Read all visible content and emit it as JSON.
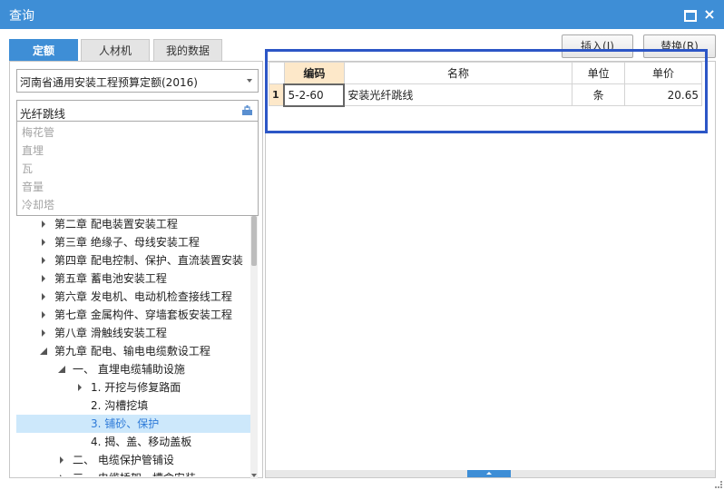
{
  "window": {
    "title": "查询"
  },
  "tabs": [
    {
      "label": "定额",
      "active": true
    },
    {
      "label": "人材机",
      "active": false
    },
    {
      "label": "我的数据",
      "active": false
    }
  ],
  "quota_select": {
    "value": "河南省通用安装工程预算定额(2016)"
  },
  "search": {
    "value": "光纤跳线"
  },
  "suggestions": [
    "梅花管",
    "直埋",
    "瓦",
    "音量",
    "冷却塔"
  ],
  "tree": [
    {
      "label": "第二章  配电装置安装工程",
      "level": 0,
      "state": "collapsed"
    },
    {
      "label": "第三章  绝缘子、母线安装工程",
      "level": 0,
      "state": "collapsed"
    },
    {
      "label": "第四章  配电控制、保护、直流装置安装",
      "level": 0,
      "state": "collapsed"
    },
    {
      "label": "第五章  蓄电池安装工程",
      "level": 0,
      "state": "collapsed"
    },
    {
      "label": "第六章  发电机、电动机检查接线工程",
      "level": 0,
      "state": "collapsed"
    },
    {
      "label": "第七章  金属构件、穿墙套板安装工程",
      "level": 0,
      "state": "collapsed"
    },
    {
      "label": "第八章  滑触线安装工程",
      "level": 0,
      "state": "collapsed"
    },
    {
      "label": "第九章  配电、输电电缆敷设工程",
      "level": 0,
      "state": "expanded"
    },
    {
      "label": "一、  直埋电缆辅助设施",
      "level": 1,
      "state": "expanded"
    },
    {
      "label": "1.  开挖与修复路面",
      "level": 2,
      "state": "collapsed"
    },
    {
      "label": "2.  沟槽挖填",
      "level": 2,
      "state": "leaf"
    },
    {
      "label": "3.  铺砂、保护",
      "level": 2,
      "state": "leaf",
      "selected": true
    },
    {
      "label": "4.  揭、盖、移动盖板",
      "level": 2,
      "state": "leaf"
    },
    {
      "label": "二、  电缆保护管铺设",
      "level": 1,
      "state": "collapsed"
    },
    {
      "label": "三、  电缆桥架、槽盒安装",
      "level": 1,
      "state": "collapsed"
    }
  ],
  "buttons": {
    "insert": "插入(I)",
    "replace": "替换(R)"
  },
  "grid": {
    "headers": {
      "code": "编码",
      "name": "名称",
      "unit": "单位",
      "price": "单价"
    },
    "rows": [
      {
        "index": "1",
        "code": "5-2-60",
        "name": "安装光纤跳线",
        "unit": "条",
        "price": "20.65"
      }
    ]
  },
  "colors": {
    "accent": "#3e8ed6",
    "highlight_box": "#2c56c6",
    "selected_row": "#cde8fb",
    "header_code_bg": "#fde8c9"
  }
}
